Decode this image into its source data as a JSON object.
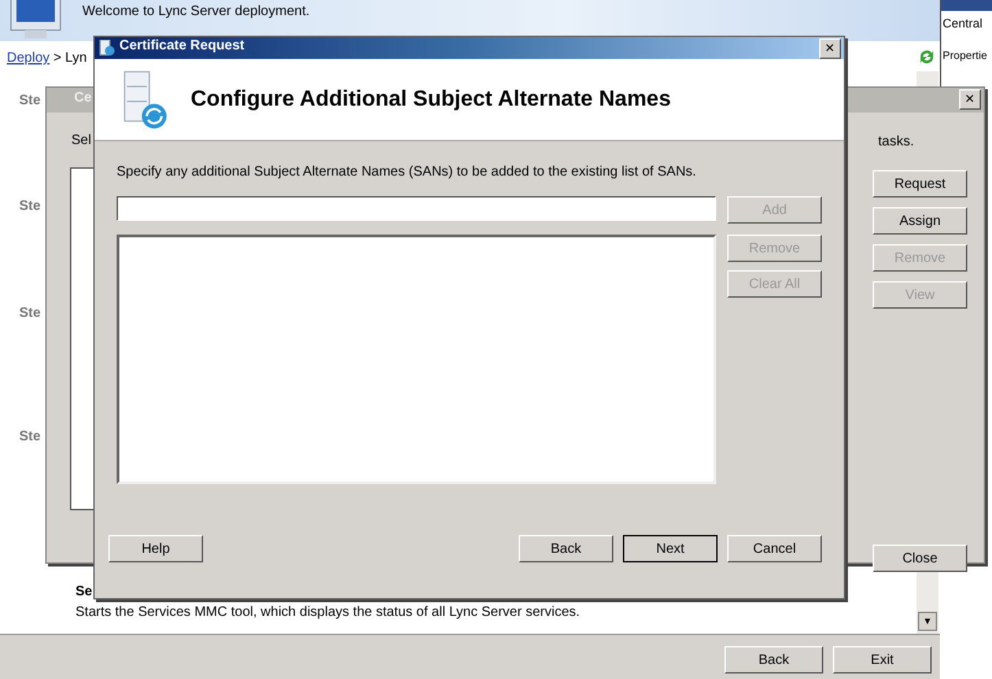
{
  "background_window": {
    "welcome": "Welcome to Lync Server deployment.",
    "breadcrumb": [
      {
        "text": "Deploy",
        "kind": "link"
      },
      {
        "text": " > Lyn",
        "kind": "plain"
      }
    ],
    "side_panel": [
      "Central",
      "Propertie"
    ],
    "scroll_down": "▼",
    "step_labels": [
      "Ste",
      "Ste",
      "Ste",
      "Ste"
    ],
    "section_heading": "Se",
    "section_text": "Starts the Services MMC tool, which displays the status of all Lync Server services.",
    "buttons": [
      {
        "label": "Back",
        "disabled": false
      },
      {
        "label": "Exit",
        "disabled": false
      }
    ]
  },
  "middle_dialog": {
    "title": "Ce",
    "close_icon": "✕",
    "intro_start": "Sel",
    "intro_end": "tasks.",
    "buttons": [
      {
        "label": "Request",
        "disabled": false
      },
      {
        "label": "Assign",
        "disabled": false
      },
      {
        "label": "Remove",
        "disabled": true
      },
      {
        "label": "View",
        "disabled": true
      }
    ],
    "close_button": "Close"
  },
  "dialog": {
    "title": "Certificate Request",
    "close_icon": "✕",
    "heading": "Configure Additional Subject Alternate Names",
    "instruction": "Specify any additional Subject Alternate Names (SANs) to be added to the existing list of SANs.",
    "side_buttons": [
      {
        "label": "Add",
        "disabled": true
      },
      {
        "label": "Remove",
        "disabled": true
      },
      {
        "label": "Clear All",
        "disabled": true
      }
    ],
    "help_button": "Help",
    "footer_buttons": [
      {
        "label": "Back",
        "disabled": false,
        "default": false
      },
      {
        "label": "Next",
        "disabled": false,
        "default": true
      },
      {
        "label": "Cancel",
        "disabled": false,
        "default": false
      }
    ]
  }
}
